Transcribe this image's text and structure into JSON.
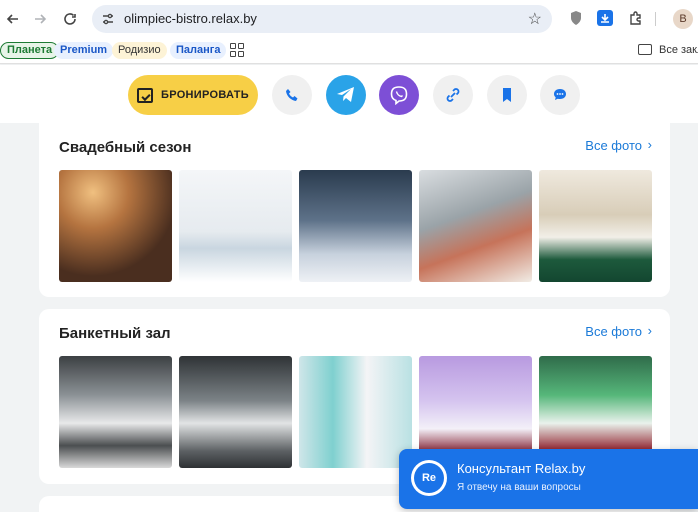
{
  "browser": {
    "url": "olimpiec-bistro.relax.by",
    "profile_initial": "B"
  },
  "bookmarks": {
    "items": [
      "Планета",
      "Premium",
      "Родизио",
      "Паланга"
    ],
    "all_label": "Все закл"
  },
  "actions": {
    "book_label": "БРОНИРОВАТЬ",
    "accent_color": "#f7cf46"
  },
  "sections": [
    {
      "title": "Свадебный сезон",
      "link": "Все фото"
    },
    {
      "title": "Банкетный зал",
      "link": "Все фото"
    }
  ],
  "consultant": {
    "avatar_text": "Re",
    "title": "Консультант Relax.by",
    "subtitle": "Я отвечу на ваши вопросы"
  }
}
